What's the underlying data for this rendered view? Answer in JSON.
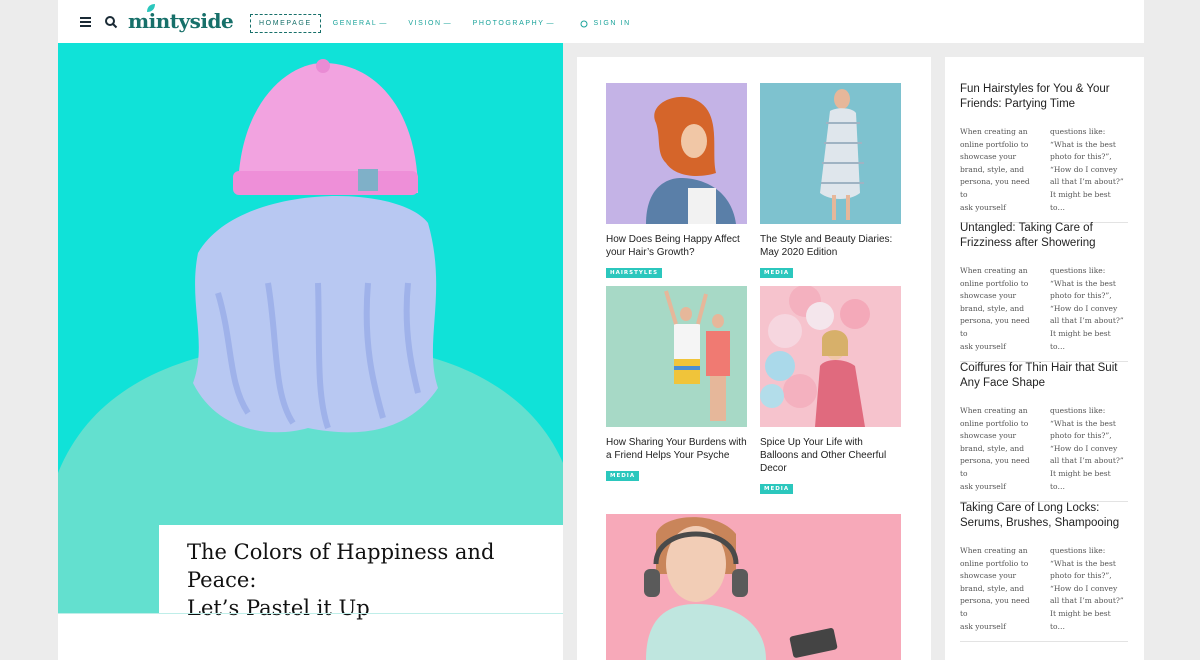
{
  "header": {
    "logo": "mintyside",
    "nav": [
      {
        "label": "HOMEPAGE"
      },
      {
        "label": "GENERAL"
      },
      {
        "label": "VISION"
      },
      {
        "label": "PHOTOGRAPHY"
      }
    ],
    "signin": "SIGN IN"
  },
  "hero": {
    "title_line1": "The Colors of Happiness and Peace:",
    "title_line2": "Let’s Pastel it Up"
  },
  "cards": [
    {
      "title": "How Does Being Happy Affect your Hair’s Growth?",
      "tag": "HAIRSTYLES"
    },
    {
      "title": "The Style and Beauty Diaries: May 2020 Edition",
      "tag": "MEDIA"
    },
    {
      "title": "How Sharing Your Burdens with a Friend Helps Your Psyche",
      "tag": "MEDIA"
    },
    {
      "title": "Spice Up Your Life with Balloons and Other Cheerful Decor",
      "tag": "MEDIA"
    }
  ],
  "posts": [
    {
      "title": "Fun Hairstyles for You & Your Friends: Partying Time",
      "excerpt_left": "When creating an\nonline portfolio to\nshowcase your\nbrand, style, and\npersona, you need to\nask yourself",
      "excerpt_right": "questions like:\n“What is the best\nphoto for this?”,\n“How do I convey\nall that I’m about?”\nIt might be best to…"
    },
    {
      "title": "Untangled: Taking Care of Frizziness after Showering",
      "excerpt_left": "When creating an\nonline portfolio to\nshowcase your\nbrand, style, and\npersona, you need to\nask yourself",
      "excerpt_right": "questions like:\n“What is the best\nphoto for this?”,\n“How do I convey\nall that I’m about?”\nIt might be best to…"
    },
    {
      "title": "Coiffures for Thin Hair that Suit Any Face Shape",
      "excerpt_left": "When creating an\nonline portfolio to\nshowcase your\nbrand, style, and\npersona, you need to\nask yourself",
      "excerpt_right": "questions like:\n“What is the best\nphoto for this?”,\n“How do I convey\nall that I’m about?”\nIt might be best to…"
    },
    {
      "title": "Taking Care of Long Locks: Serums, Brushes, Shampooing",
      "excerpt_left": "When creating an\nonline portfolio to\nshowcase your\nbrand, style, and\npersona, you need to\nask yourself",
      "excerpt_right": "questions like:\n“What is the best\nphoto for this?”,\n“How do I convey\nall that I’m about?”\nIt might be best to…"
    }
  ],
  "colors": {
    "accent": "#17706a",
    "mint": "#0fe0d6",
    "tag": "#2bc7bd"
  }
}
